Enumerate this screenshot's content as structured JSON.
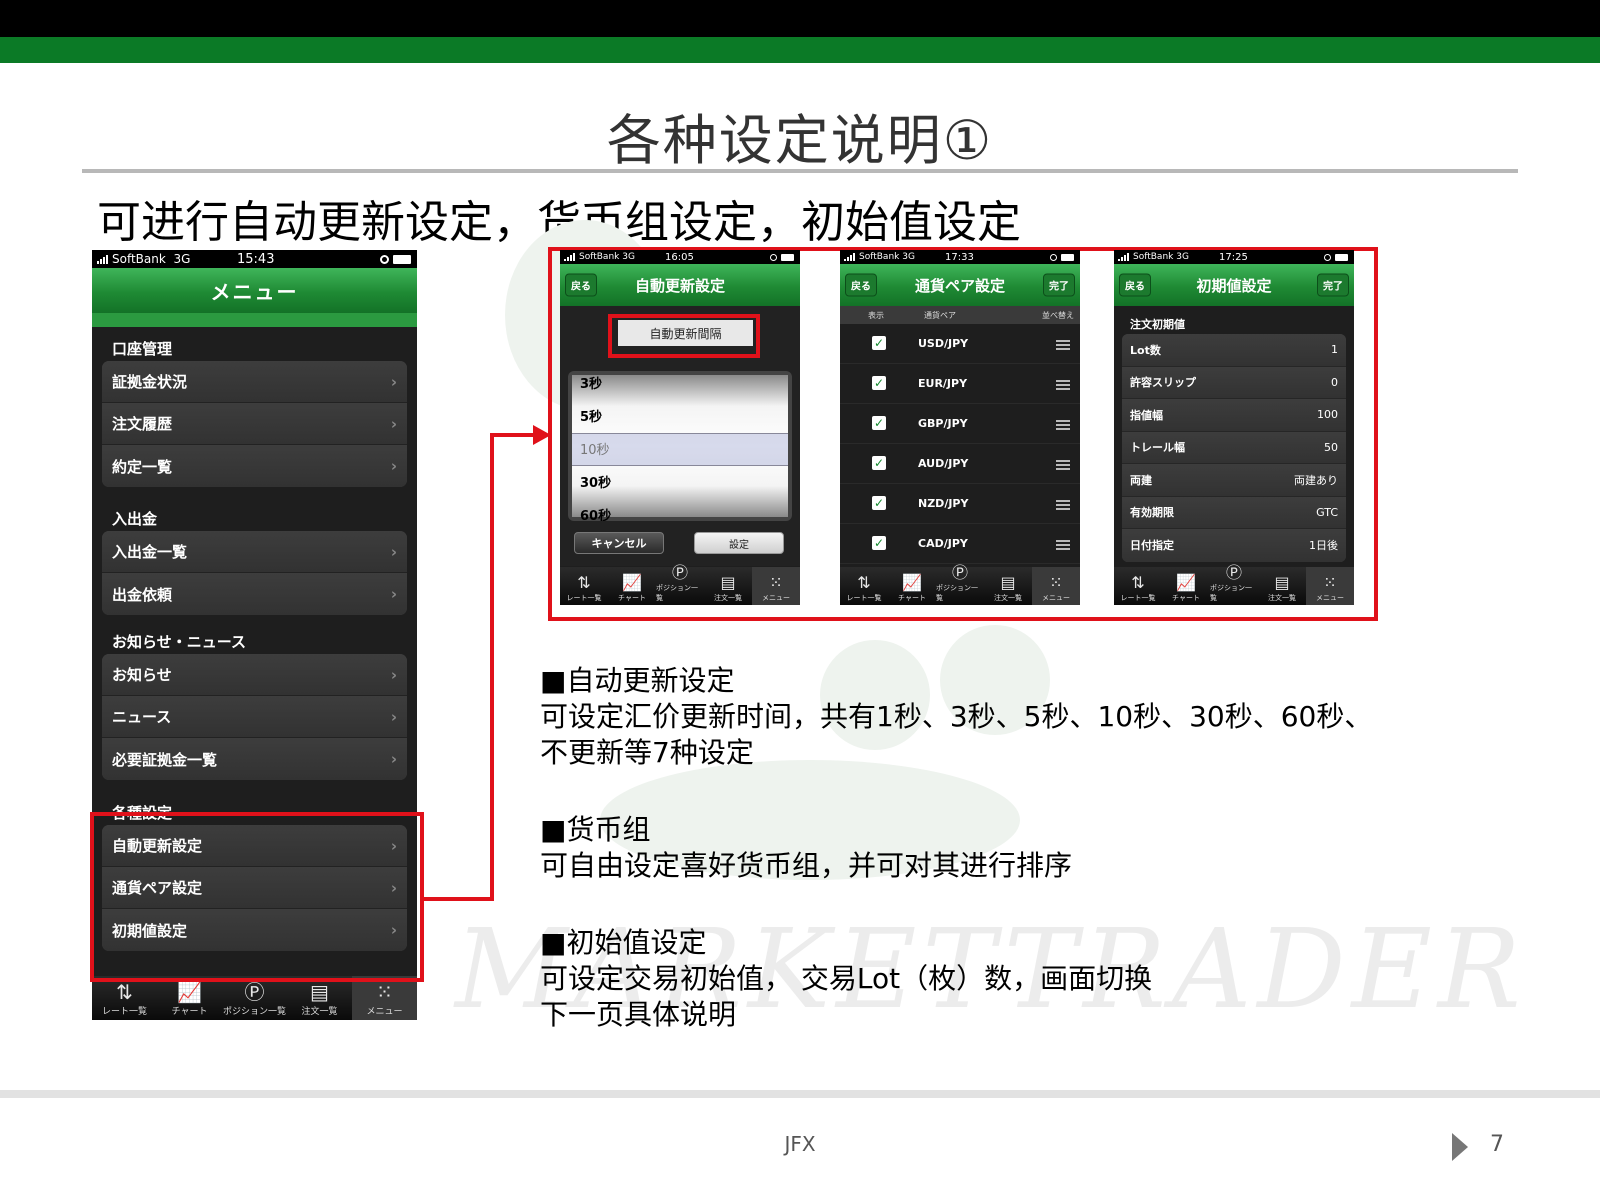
{
  "slide": {
    "title": "各种设定说明①",
    "subtitle": "可进行自动更新设定，货币组设定，初始值设定",
    "footer_center": "JFX",
    "page_number": "7",
    "watermark": "MARKETTRADER"
  },
  "colors": {
    "accent_green": "#0b7a26",
    "highlight_red": "#e0111a"
  },
  "menu_phone": {
    "carrier": "SoftBank",
    "network": "3G",
    "time": "15:43",
    "nav_title": "メニュー",
    "sections": [
      {
        "label": "口座管理",
        "items": [
          "証拠金状況",
          "注文履歴",
          "約定一覧"
        ]
      },
      {
        "label": "入出金",
        "items": [
          "入出金一覧",
          "出金依頼"
        ]
      },
      {
        "label": "お知らせ・ニュース",
        "items": [
          "お知らせ",
          "ニュース",
          "必要証拠金一覧"
        ]
      },
      {
        "label": "各種設定",
        "items": [
          "自動更新設定",
          "通貨ペア設定",
          "初期値設定"
        ]
      }
    ]
  },
  "tabbar": {
    "tabs": [
      {
        "label": "レート一覧",
        "icon": "rates-arrows-icon",
        "glyph": "⇅"
      },
      {
        "label": "チャート",
        "icon": "chart-icon",
        "glyph": "📈"
      },
      {
        "label": "ポジション一覧",
        "icon": "position-p-icon",
        "glyph": "Ⓟ"
      },
      {
        "label": "注文一覧",
        "icon": "order-list-icon",
        "glyph": "▤"
      },
      {
        "label": "メニュー",
        "icon": "menu-grid-icon",
        "glyph": "⁙"
      }
    ]
  },
  "auto_update_phone": {
    "carrier": "SoftBank",
    "network": "3G",
    "time": "16:05",
    "back_label": "戻る",
    "nav_title": "自動更新設定",
    "interval_label": "自動更新間隔",
    "picker_options": [
      "3秒",
      "5秒",
      "10秒",
      "30秒",
      "60秒"
    ],
    "selected_option": "10秒",
    "cancel_label": "キャンセル",
    "set_label": "設定"
  },
  "pair_phone": {
    "carrier": "SoftBank",
    "network": "3G",
    "time": "17:33",
    "back_label": "戻る",
    "nav_title": "通貨ペア設定",
    "done_label": "完了",
    "col_show": "表示",
    "col_pair": "通貨ペア",
    "col_sort": "並べ替え",
    "pairs": [
      "USD/JPY",
      "EUR/JPY",
      "GBP/JPY",
      "AUD/JPY",
      "NZD/JPY",
      "CAD/JPY"
    ]
  },
  "initial_phone": {
    "carrier": "SoftBank",
    "network": "3G",
    "time": "17:25",
    "back_label": "戻る",
    "nav_title": "初期値設定",
    "done_label": "完了",
    "group_label": "注文初期値",
    "rows": [
      {
        "label": "Lot数",
        "value": "1"
      },
      {
        "label": "許容スリップ",
        "value": "0"
      },
      {
        "label": "指値幅",
        "value": "100"
      },
      {
        "label": "トレール幅",
        "value": "50"
      },
      {
        "label": "両建",
        "value": "両建あり"
      },
      {
        "label": "有効期限",
        "value": "GTC"
      },
      {
        "label": "日付指定",
        "value": "1日後"
      }
    ]
  },
  "descriptions": [
    {
      "heading": "■自动更新设定",
      "lines": [
        "可设定汇价更新时间，共有1秒、3秒、5秒、10秒、30秒、60秒、",
        "不更新等7种设定"
      ]
    },
    {
      "heading": "■货币组",
      "lines": [
        "可自由设定喜好货币组，并可对其进行排序"
      ]
    },
    {
      "heading": "■初始值设定",
      "lines": [
        "可设定交易初始值， 交易Lot（枚）数，画面切换",
        "下一页具体说明"
      ]
    }
  ]
}
